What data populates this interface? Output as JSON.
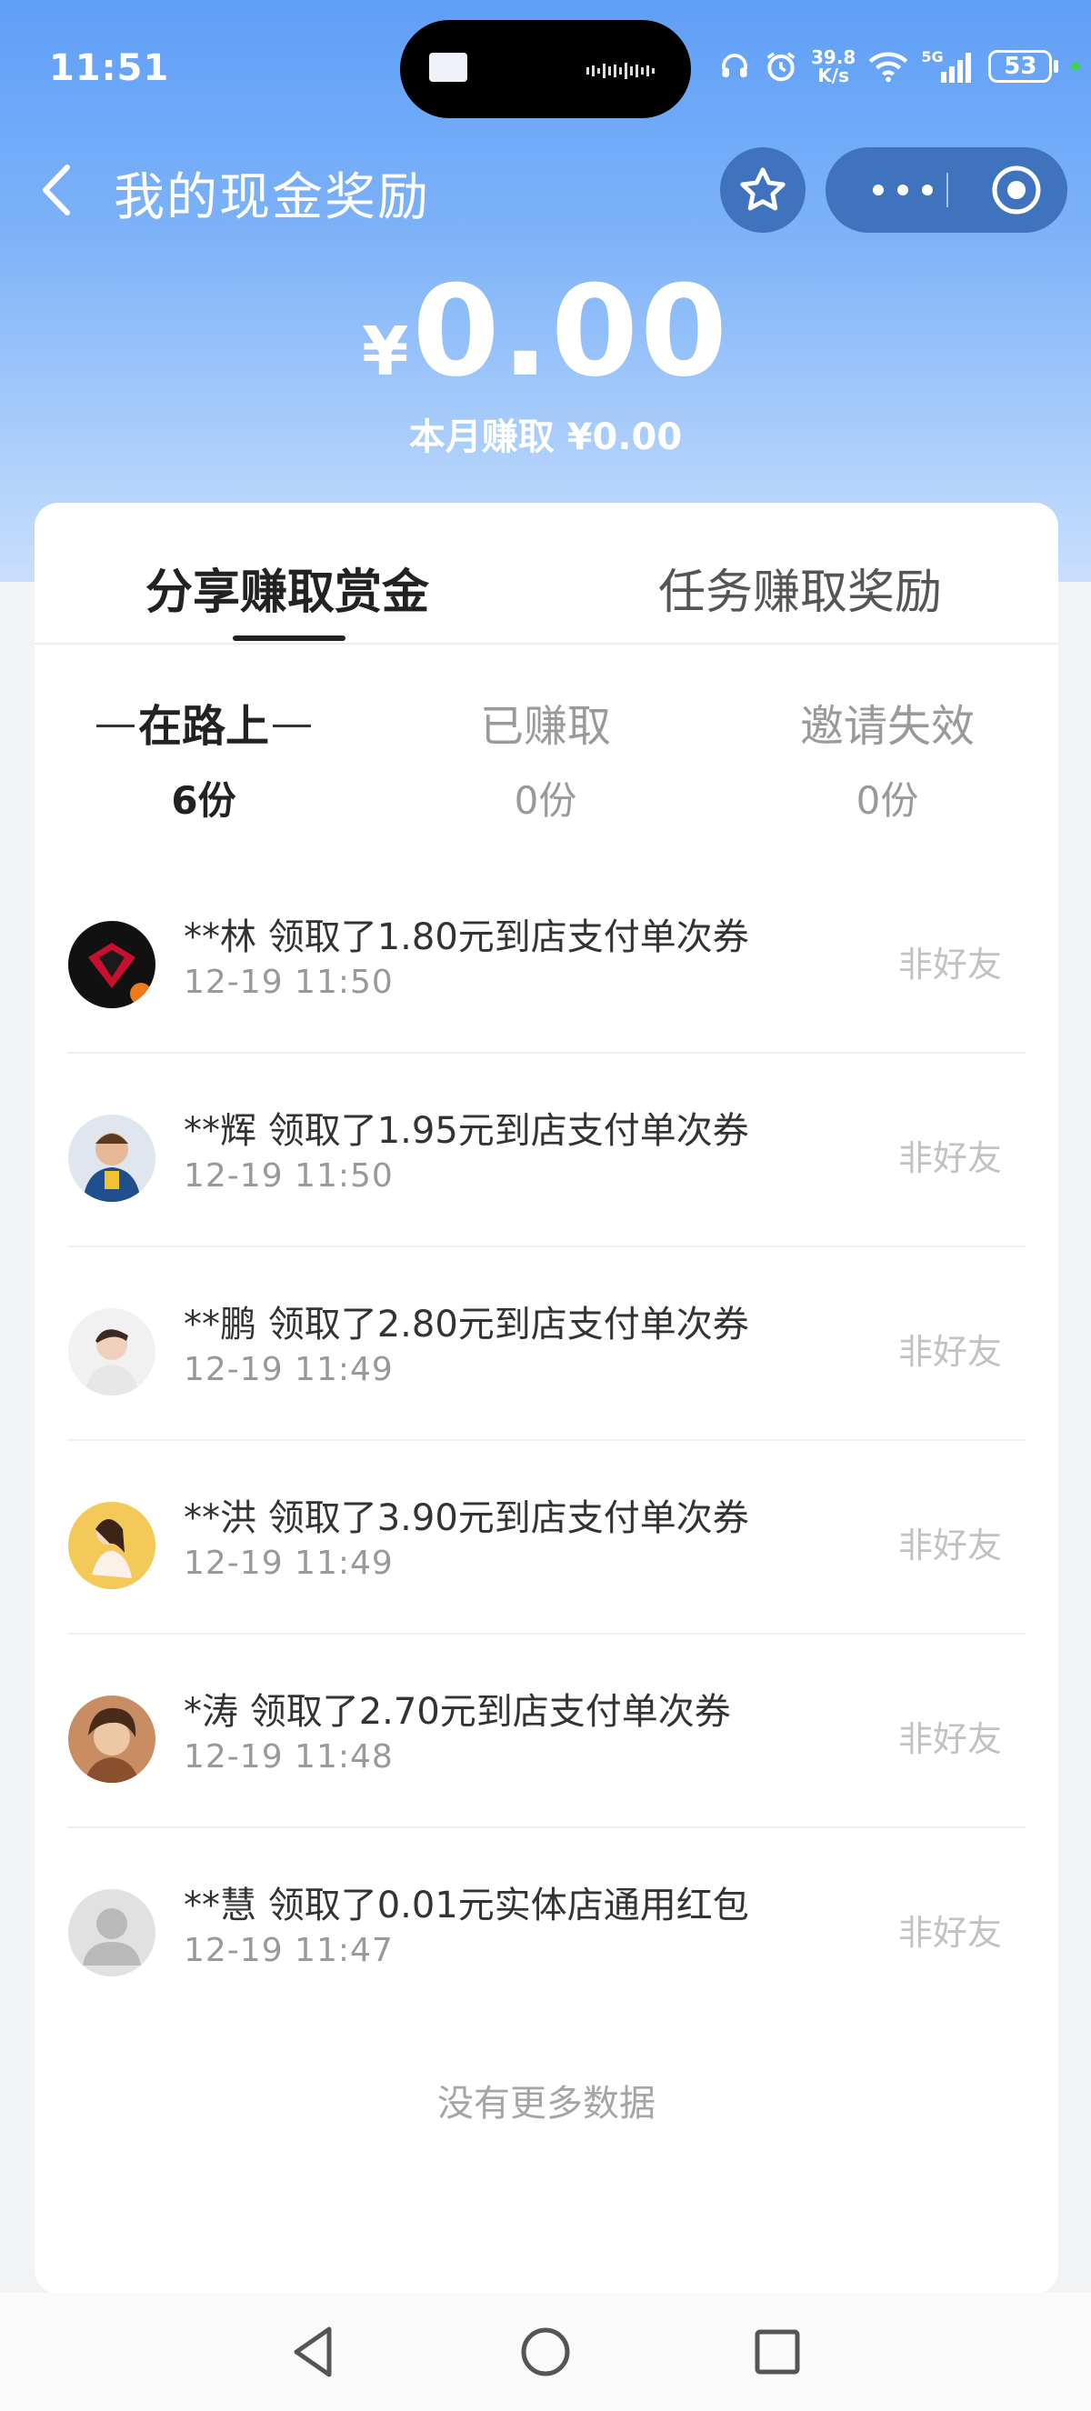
{
  "status_bar": {
    "time": "11:51",
    "net_speed_value": "39.8",
    "net_speed_unit": "K/s",
    "network_label": "5G",
    "battery": "53",
    "icons": [
      "headset-icon",
      "alarm-icon",
      "wifi-icon",
      "signal-icon",
      "battery-icon"
    ]
  },
  "nav": {
    "title": "我的现金奖励"
  },
  "summary": {
    "currency": "¥",
    "amount": "0.00",
    "monthly_label": "本月赚取 ¥0.00"
  },
  "tabs": [
    {
      "label": "分享赚取赏金",
      "active": true
    },
    {
      "label": "任务赚取奖励",
      "active": false
    }
  ],
  "filters": [
    {
      "label": "在路上",
      "count": "6份",
      "active": true
    },
    {
      "label": "已赚取",
      "count": "0份",
      "active": false
    },
    {
      "label": "邀请失效",
      "count": "0份",
      "active": false
    }
  ],
  "records": [
    {
      "text": "**林 领取了1.80元到店支付单次券",
      "time": "12-19 11:50",
      "tag": "非好友"
    },
    {
      "text": "**辉 领取了1.95元到店支付单次券",
      "time": "12-19 11:50",
      "tag": "非好友"
    },
    {
      "text": "**鹏 领取了2.80元到店支付单次券",
      "time": "12-19 11:49",
      "tag": "非好友"
    },
    {
      "text": "**洪 领取了3.90元到店支付单次券",
      "time": "12-19 11:49",
      "tag": "非好友"
    },
    {
      "text": "*涛 领取了2.70元到店支付单次券",
      "time": "12-19 11:48",
      "tag": "非好友"
    },
    {
      "text": "**慧 领取了0.01元实体店通用红包",
      "time": "12-19 11:47",
      "tag": "非好友"
    }
  ],
  "footer": {
    "no_more": "没有更多数据"
  },
  "colors": {
    "header_gradient_top": "#5f9ff7",
    "header_gradient_bottom": "#c9dffc",
    "capsule_bg": "#3f73bd",
    "active_text": "#222222",
    "muted_text": "#999999"
  }
}
